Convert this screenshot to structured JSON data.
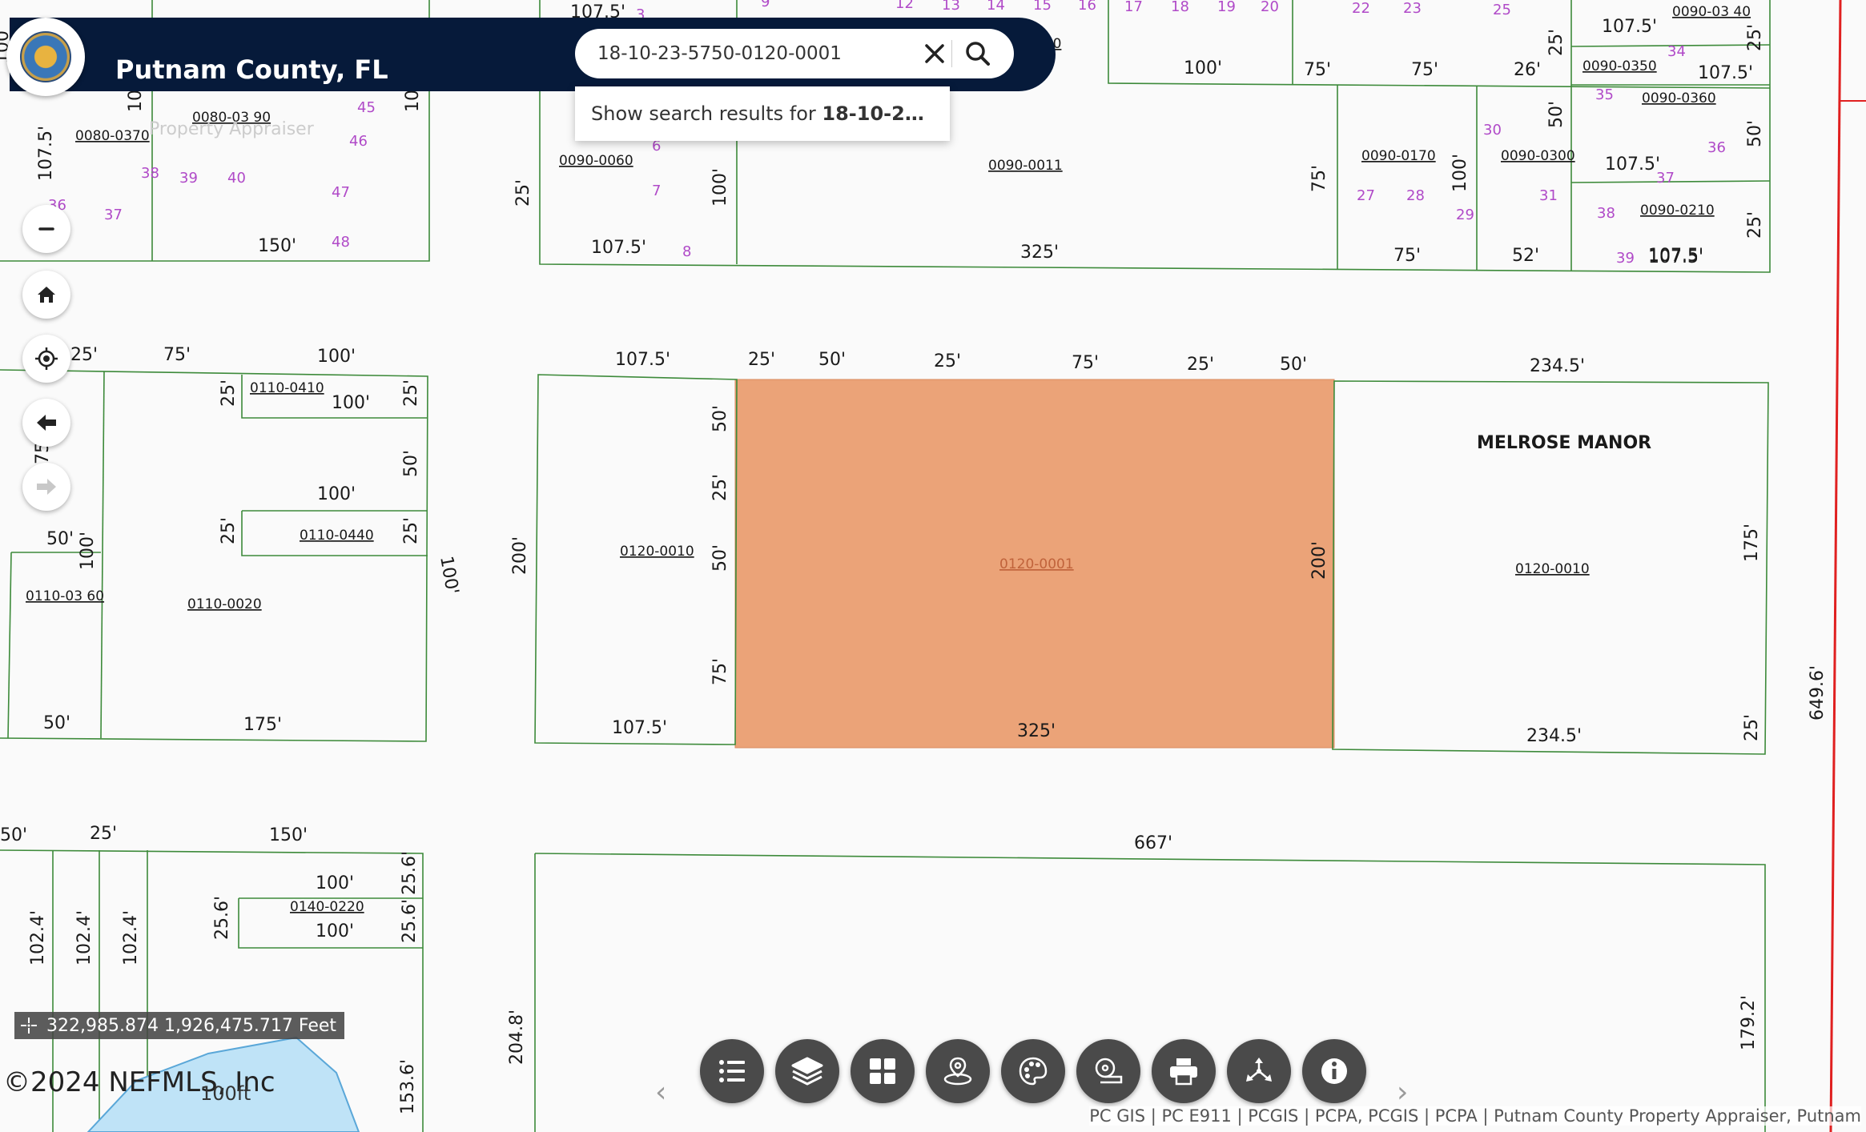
{
  "header": {
    "app_title": "Putnam County, FL",
    "logo_icon": "county-seal-icon"
  },
  "search": {
    "value": "18-10-23-5750-0120-0001",
    "placeholder": "",
    "suggestion_prefix": "Show search results for ",
    "suggestion_bold": "18-10-2…"
  },
  "controls": {
    "icons": [
      "zoom-out-icon",
      "home-icon",
      "locate-icon",
      "back-icon",
      "forward-icon"
    ]
  },
  "map": {
    "selected_fill": "#eba378",
    "lot_line_color": "#3d8a3a",
    "boundary_color": "#e02020",
    "subdivision_name": "MELROSE MANOR",
    "selected_parcel": "0120-0001",
    "parcel_ids": [
      "0080-0370",
      "0080-03 90",
      "0090-0060",
      "0090-0011",
      "0090-0170",
      "0090-0300",
      "0090-0360",
      "0090-0210",
      "0090-0350",
      "0090-03 40",
      "0110-0410",
      "0110-0440",
      "0110-03 60",
      "0110-0020",
      "0120-0010",
      "0120-0001",
      "0120-0010",
      "0140-0220",
      "-0150"
    ],
    "dimensions": [
      "107.5'",
      "25'",
      "50'",
      "25'",
      "75'",
      "25'",
      "50'",
      "234.5'",
      "50'",
      "25'",
      "50'",
      "75'",
      "200'",
      "200'",
      "175'",
      "25'",
      "107.5'",
      "325'",
      "234.5'",
      "649.6'",
      "667'",
      "204.8'",
      "179.2'",
      "100'",
      "25'",
      "75'",
      "25'",
      "25'",
      "100'",
      "100'",
      "50'",
      "175'",
      "50'",
      "25'",
      "150'",
      "100'",
      "100'",
      "25.6'",
      "25.6'",
      "25.6'",
      "102.4'",
      "102.4'",
      "102.4'",
      "153.6'",
      "150'",
      "107.5'",
      "107.5'",
      "325'",
      "75'",
      "52'",
      "107.5'",
      "100'",
      "100'",
      "75'",
      "26'",
      "25'",
      "107.5'",
      "107.5'",
      "50'",
      "50'",
      "25'",
      "100'",
      "100'",
      "75'",
      "75'",
      "100'",
      "100'",
      "25'",
      "100'",
      "100'",
      "25'",
      "100'",
      "107.5'"
    ],
    "lot_numbers": [
      "3",
      "9",
      "12",
      "13",
      "14",
      "15",
      "16",
      "17",
      "18",
      "19",
      "20",
      "22",
      "23",
      "25",
      "34",
      "35",
      "30",
      "36",
      "37",
      "38",
      "39",
      "27",
      "28",
      "29",
      "31",
      "45",
      "46",
      "47",
      "48",
      "39",
      "40",
      "37",
      "38",
      "36",
      "6",
      "7",
      "8"
    ],
    "faint_label": "Property Appraiser"
  },
  "status": {
    "coordinates": "322,985.874 1,926,475.717 Feet",
    "copyright": "©2024 NEFMLS, Inc",
    "scale": "100ft"
  },
  "toolbar": {
    "icons": [
      "list-icon",
      "layers-icon",
      "grid-icon",
      "map-pin-icon",
      "palette-icon",
      "measure-icon",
      "print-icon",
      "share-icon",
      "info-icon"
    ]
  },
  "attribution": "PC GIS | PC E911 | PCGIS | PCPA, PCGIS | PCPA | Putnam County Property Appraiser, Putnam"
}
